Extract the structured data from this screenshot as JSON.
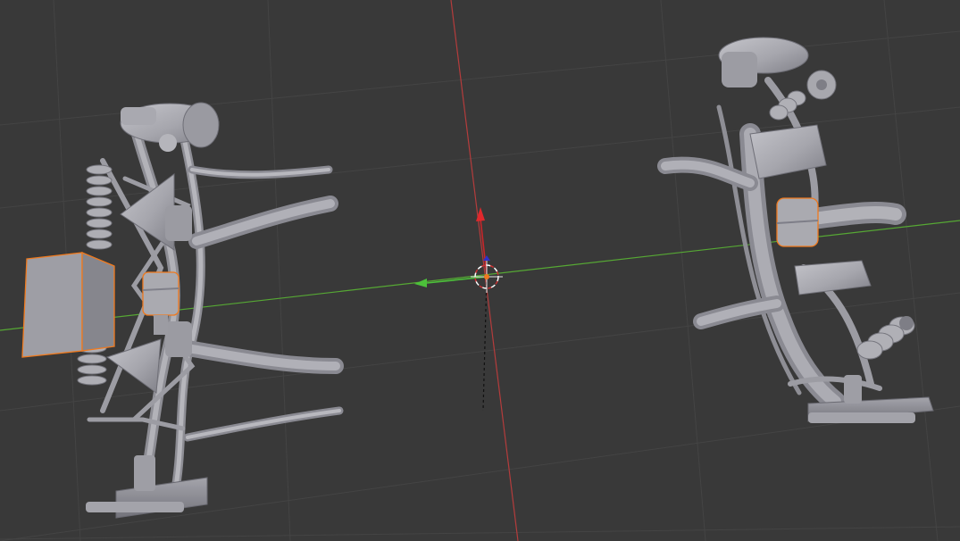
{
  "viewport": {
    "background": "#393939",
    "grid_color": "#444444",
    "x_axis_color": "#b43c3c",
    "y_axis_color": "#56a834",
    "selection_outline_color": "#f07a1e",
    "mesh_color": "#a6a6ad",
    "mesh_shadow_color": "#7c7c83",
    "mesh_highlight_color": "#c4c4ca"
  },
  "scene": {
    "objects": [
      {
        "name": "left-suspension-assembly",
        "selected_parts": 2
      },
      {
        "name": "right-suspension-assembly",
        "selected_parts": 1
      }
    ],
    "gizmos": [
      "3d-cursor",
      "transform-manipulator"
    ]
  }
}
